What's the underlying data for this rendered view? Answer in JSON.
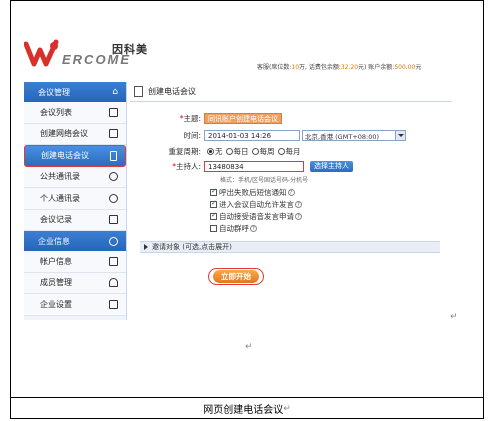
{
  "brand": {
    "logo_cn": "因科美",
    "logo_en": "ERCOME"
  },
  "account": {
    "prefix": "客服(席位数:",
    "seats": "10",
    "mid1": "万, 话费包余额:",
    "balance": "32.20",
    "mid2": "元) 账户余额:",
    "account_balance": "500.00",
    "suffix": "元"
  },
  "sidebar": {
    "section1": "会议管理",
    "items1": [
      {
        "label": "会议列表"
      },
      {
        "label": "创建网络会议"
      },
      {
        "label": "创建电话会议"
      },
      {
        "label": "公共通讯录"
      },
      {
        "label": "个人通讯录"
      },
      {
        "label": "会议记录"
      }
    ],
    "section2": "企业信息",
    "items2": [
      {
        "label": "帐户信息"
      },
      {
        "label": "成员管理"
      },
      {
        "label": "企业设置"
      }
    ]
  },
  "page": {
    "title": "创建电话会议"
  },
  "form": {
    "subject_label": "主题:",
    "subject_value": "同讯账户创建电话会议",
    "time_label": "时间:",
    "time_value": "2014-01-03 14:26",
    "timezone_value": "北京,香港 (GMT+08:00)",
    "repeat_label": "重复周期:",
    "repeat_options": [
      "无",
      "每日",
      "每周",
      "每月"
    ],
    "host_label": "主持人:",
    "host_value": "13480834",
    "select_host_button": "选择主持人",
    "host_hint": "格式：手机/区号固话号码-分机号",
    "options": [
      {
        "label": "呼出失败后短信通知"
      },
      {
        "label": "进入会议自动允许发言"
      },
      {
        "label": "自动接受语音发言申请"
      },
      {
        "label": "自动群呼"
      }
    ],
    "invite_label": "邀请对象 (可选,点击展开)",
    "start_button": "立即开始"
  },
  "caption": "网页创建电话会议"
}
